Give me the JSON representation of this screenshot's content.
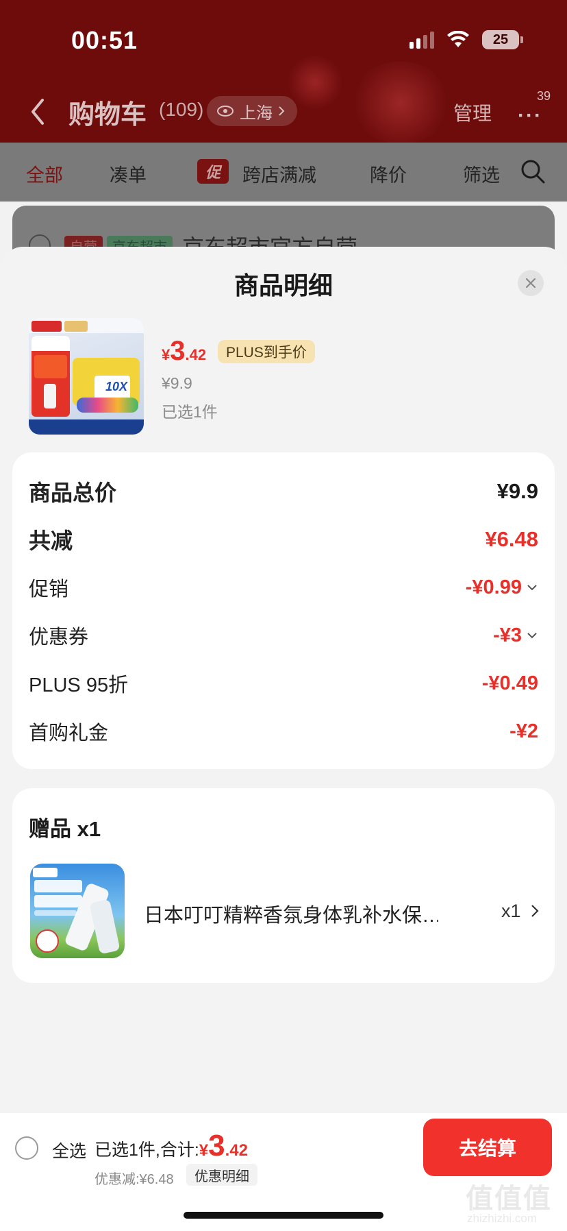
{
  "status_bar": {
    "time": "00:51",
    "battery": "25"
  },
  "cart_header": {
    "title": "购物车",
    "count": "(109)",
    "location": "上海",
    "manage_label": "管理",
    "more_badge": "39"
  },
  "filter_bar": {
    "tabs": [
      "全部",
      "凑单",
      "跨店满减",
      "降价",
      "筛选"
    ],
    "promo_tag": "促",
    "active_color": "#e8302b"
  },
  "store_row": {
    "tag_self": "自营",
    "tag_supermarket": "京东超市",
    "name": "京东超市官方自营"
  },
  "sheet": {
    "title": "商品明细",
    "product": {
      "price_symbol": "¥",
      "price_int": "3",
      "price_dec": ".42",
      "plus_badge": "PLUS到手价",
      "original_price": "¥9.9",
      "selected": "已选1件"
    },
    "summary": {
      "total_label": "商品总价",
      "total_value": "¥9.9",
      "reduce_label": "共减",
      "reduce_value": "¥6.48",
      "promo_label": "促销",
      "promo_value": "-¥0.99",
      "coupon_label": "优惠券",
      "coupon_value": "-¥3",
      "plus_label": "PLUS 95折",
      "plus_value": "-¥0.49",
      "first_buy_label": "首购礼金",
      "first_buy_value": "-¥2"
    },
    "gift": {
      "title": "赠品 x1",
      "name": "日本叮叮精粹香氛身体乳补水保…",
      "qty": "x1"
    }
  },
  "bottom_bar": {
    "select_all": "全选",
    "total_prefix": "已选1件,合计:",
    "total_symbol": "¥",
    "total_int": "3",
    "total_dec": ".42",
    "discount": "优惠减:¥6.48",
    "detail_button": "优惠明细",
    "checkout_button": "去结算"
  },
  "watermark": {
    "logo": "值值值",
    "url": "zhizhizhi.com"
  },
  "colors": {
    "accent_red": "#e8302b",
    "checkout_red": "#f0312c",
    "plus_gold": "#f7e3b2",
    "header_dark_red": "#6e0c0c"
  }
}
